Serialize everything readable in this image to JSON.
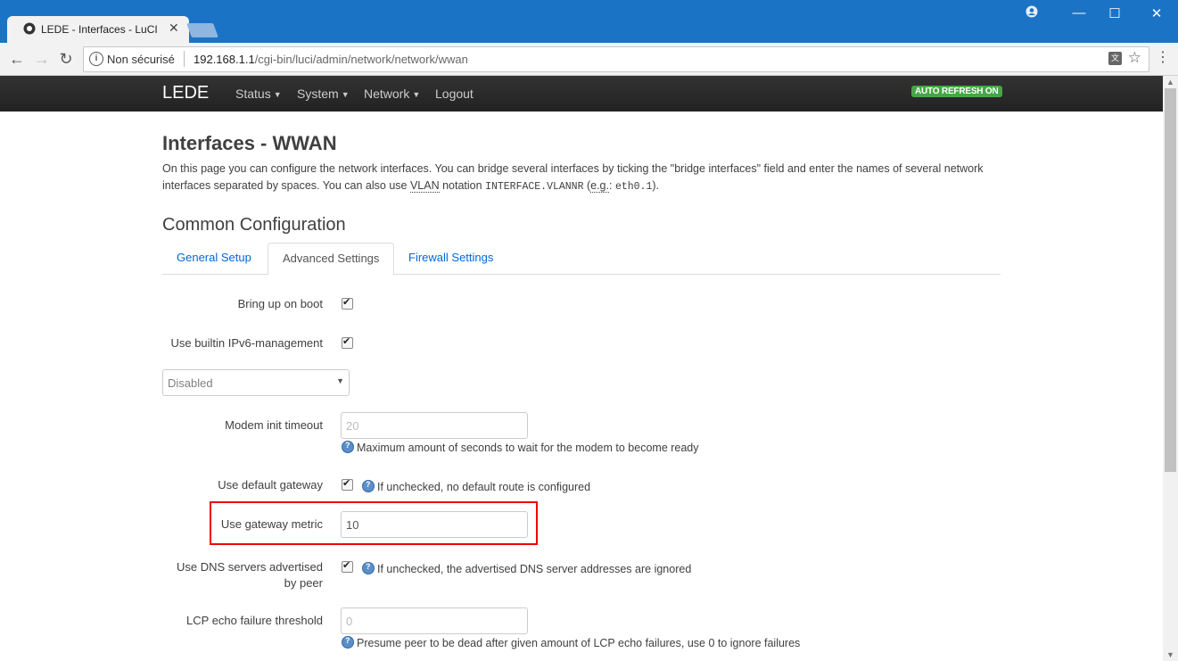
{
  "browser": {
    "tab_title": "LEDE - Interfaces - LuCI",
    "security_label": "Non sécurisé",
    "url_host": "192.168.1.1",
    "url_path": "/cgi-bin/luci/admin/network/network/wwan"
  },
  "navbar": {
    "brand": "LEDE",
    "items": [
      {
        "label": "Status",
        "dropdown": true
      },
      {
        "label": "System",
        "dropdown": true
      },
      {
        "label": "Network",
        "dropdown": true
      },
      {
        "label": "Logout",
        "dropdown": false
      }
    ],
    "auto_refresh": "AUTO REFRESH ON",
    "auto_refresh_color": "#46a546"
  },
  "page": {
    "title": "Interfaces - WWAN",
    "desc_1": "On this page you can configure the network interfaces. You can bridge several interfaces by ticking the \"bridge interfaces\" field and enter the names of several network interfaces separated by spaces. You can also use ",
    "desc_vlan": "VLAN",
    "desc_2": " notation ",
    "desc_code": "INTERFACE.VLANNR",
    "desc_3": " (",
    "desc_eg": "e.g.",
    "desc_4": ": ",
    "desc_code2": "eth0.1",
    "desc_5": ")."
  },
  "section": {
    "title": "Common Configuration",
    "tabs": [
      "General Setup",
      "Advanced Settings",
      "Firewall Settings"
    ],
    "active_tab": "Advanced Settings"
  },
  "fields": {
    "bring_up_on_boot": {
      "label": "Bring up on boot",
      "checked": true
    },
    "ipv6_mgmt": {
      "label": "Use builtin IPv6-management",
      "checked": true
    },
    "select_value": "Disabled",
    "modem_init_timeout": {
      "label": "Modem init timeout",
      "placeholder": "20",
      "hint": "Maximum amount of seconds to wait for the modem to become ready"
    },
    "default_gateway": {
      "label": "Use default gateway",
      "checked": true,
      "hint": "If unchecked, no default route is configured"
    },
    "gateway_metric": {
      "label": "Use gateway metric",
      "value": "10"
    },
    "dns_servers": {
      "label_1": "Use DNS servers advertised",
      "label_2": "by peer",
      "checked": true,
      "hint": "If unchecked, the advertised DNS server addresses are ignored"
    },
    "lcp_threshold": {
      "label": "LCP echo failure threshold",
      "placeholder": "0",
      "hint": "Presume peer to be dead after given amount of LCP echo failures, use 0 to ignore failures"
    }
  },
  "highlight_color": "#e00000"
}
